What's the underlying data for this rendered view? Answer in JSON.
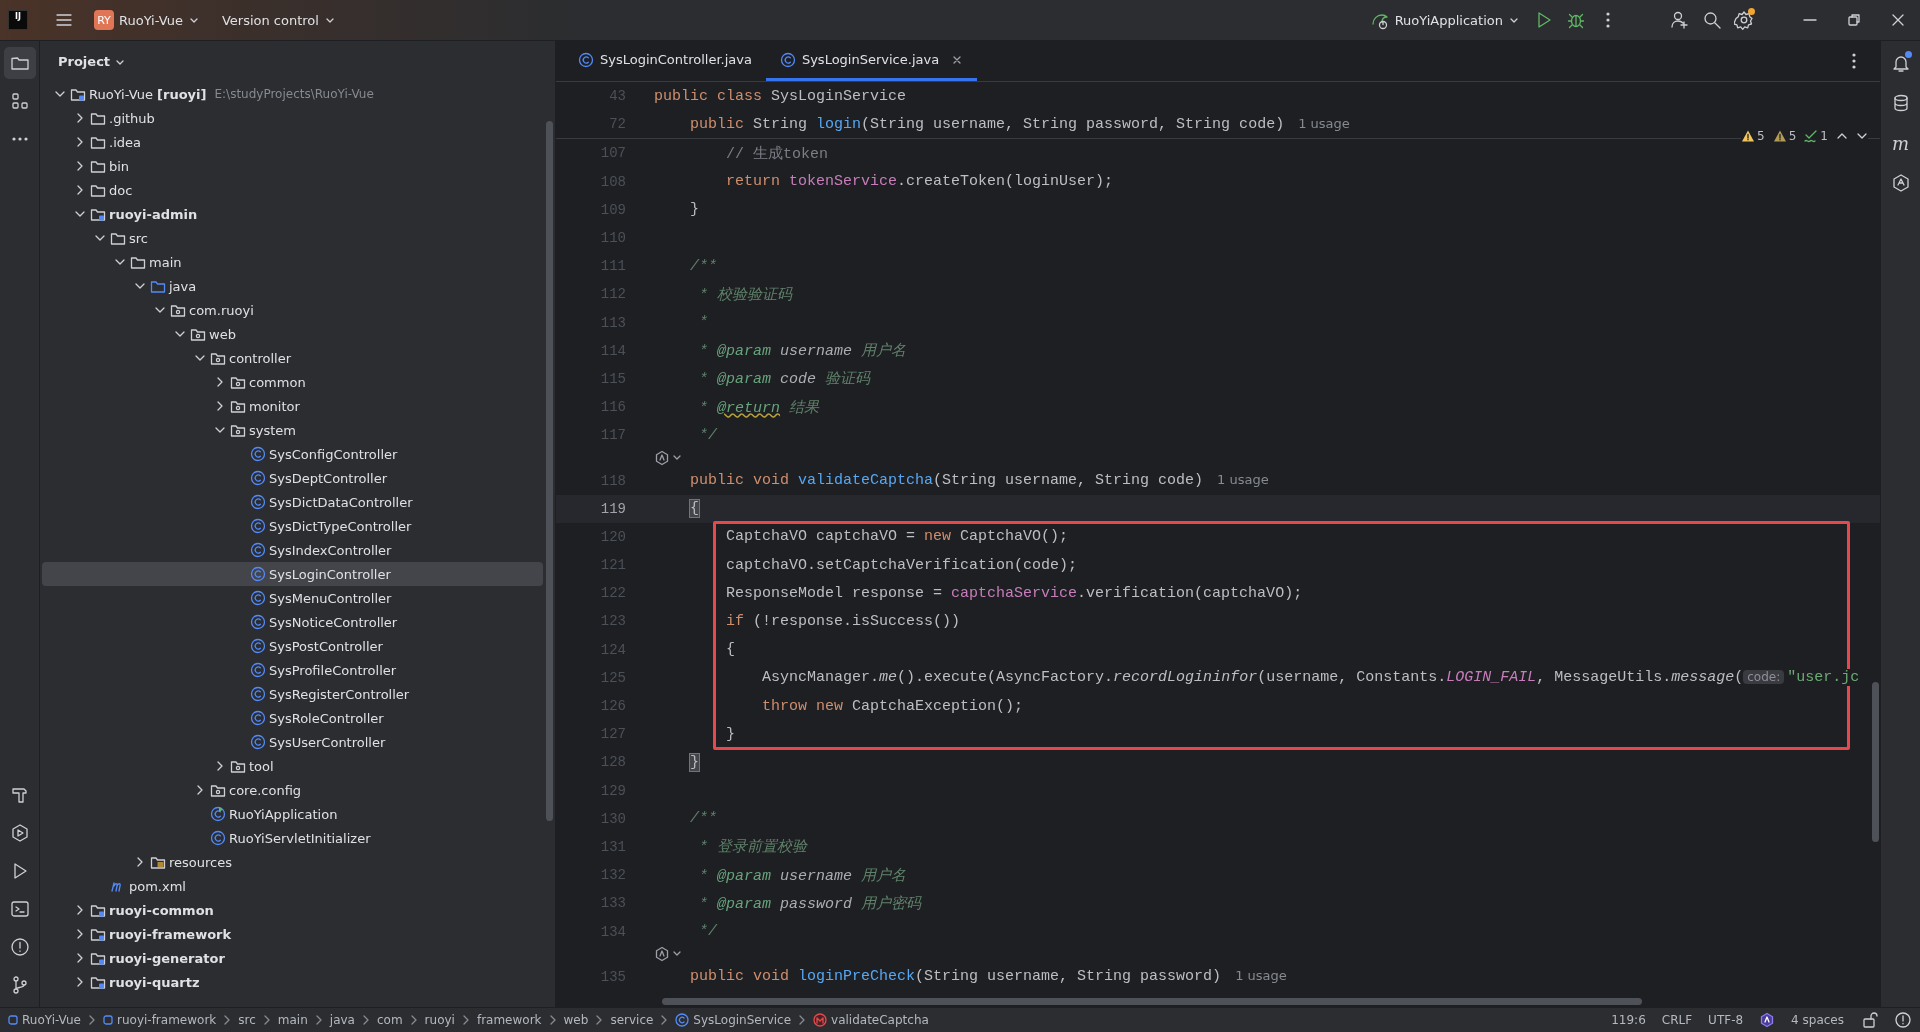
{
  "title_bar": {
    "logo": "IJ",
    "project_badge": "RY",
    "project": "RuoYi-Vue",
    "vcs": "Version control",
    "run_config": "RuoYiApplication",
    "settings_update": true
  },
  "left_toolbar": {
    "top": [
      {
        "selected": true
      },
      {
        "selected": false
      },
      {
        "selected": false
      }
    ],
    "bottom": [
      {
        "selected": false
      },
      {
        "selected": false
      },
      {
        "selected": false
      },
      {
        "selected": false
      },
      {
        "selected": false
      },
      {
        "selected": false
      }
    ]
  },
  "project_panel": {
    "title": "Project",
    "tree": [
      {
        "name": "RuoYi-Vue **[ruoyi]**",
        "hint": "E:\\studyProjects\\RuoYi-Vue",
        "kind": "module",
        "expanded": true,
        "selected": false,
        "children": [
          {
            "name": ".github",
            "kind": "folder",
            "expanded": false,
            "selected": false
          },
          {
            "name": ".idea",
            "kind": "folder",
            "expanded": false,
            "selected": false
          },
          {
            "name": "bin",
            "kind": "folder",
            "expanded": false,
            "selected": false
          },
          {
            "name": "doc",
            "kind": "folder",
            "expanded": false,
            "selected": false
          },
          {
            "name": "ruoyi-admin",
            "kind": "module",
            "bold": true,
            "expanded": true,
            "selected": false,
            "children": [
              {
                "name": "src",
                "kind": "folder",
                "expanded": true,
                "selected": false,
                "children": [
                  {
                    "name": "main",
                    "kind": "folder",
                    "expanded": true,
                    "selected": false,
                    "children": [
                      {
                        "name": "java",
                        "kind": "source",
                        "expanded": true,
                        "selected": false,
                        "children": [
                          {
                            "name": "com.ruoyi",
                            "kind": "package",
                            "expanded": true,
                            "selected": false,
                            "children": [
                              {
                                "name": "web",
                                "kind": "package",
                                "expanded": true,
                                "selected": false,
                                "children": [
                                  {
                                    "name": "controller",
                                    "kind": "package",
                                    "expanded": true,
                                    "selected": false,
                                    "children": [
                                      {
                                        "name": "common",
                                        "kind": "package",
                                        "expanded": false,
                                        "selected": false
                                      },
                                      {
                                        "name": "monitor",
                                        "kind": "package",
                                        "expanded": false,
                                        "selected": false
                                      },
                                      {
                                        "name": "system",
                                        "kind": "package",
                                        "expanded": true,
                                        "selected": false,
                                        "children": [
                                          {
                                            "name": "SysConfigController",
                                            "kind": "class",
                                            "selected": false
                                          },
                                          {
                                            "name": "SysDeptController",
                                            "kind": "class",
                                            "selected": false
                                          },
                                          {
                                            "name": "SysDictDataController",
                                            "kind": "class",
                                            "selected": false
                                          },
                                          {
                                            "name": "SysDictTypeController",
                                            "kind": "class",
                                            "selected": false
                                          },
                                          {
                                            "name": "SysIndexController",
                                            "kind": "class",
                                            "selected": false
                                          },
                                          {
                                            "name": "SysLoginController",
                                            "kind": "class",
                                            "selected": true
                                          },
                                          {
                                            "name": "SysMenuController",
                                            "kind": "class",
                                            "selected": false
                                          },
                                          {
                                            "name": "SysNoticeController",
                                            "kind": "class",
                                            "selected": false
                                          },
                                          {
                                            "name": "SysPostController",
                                            "kind": "class",
                                            "selected": false
                                          },
                                          {
                                            "name": "SysProfileController",
                                            "kind": "class",
                                            "selected": false
                                          },
                                          {
                                            "name": "SysRegisterController",
                                            "kind": "class",
                                            "selected": false
                                          },
                                          {
                                            "name": "SysRoleController",
                                            "kind": "class",
                                            "selected": false
                                          },
                                          {
                                            "name": "SysUserController",
                                            "kind": "class",
                                            "selected": false
                                          }
                                        ]
                                      },
                                      {
                                        "name": "tool",
                                        "kind": "package",
                                        "expanded": false,
                                        "selected": false
                                      }
                                    ]
                                  },
                                  {
                                    "name": "core.config",
                                    "kind": "package",
                                    "expanded": false,
                                    "selected": false
                                  },
                                  {
                                    "name": "RuoYiApplication",
                                    "kind": "app",
                                    "selected": false
                                  },
                                  {
                                    "name": "RuoYiServletInitializer",
                                    "kind": "class",
                                    "selected": false
                                  }
                                ]
                              }
                            ]
                          }
                        ]
                      },
                      {
                        "name": "resources",
                        "kind": "resources",
                        "expanded": false,
                        "selected": false
                      }
                    ]
                  }
                ]
              },
              {
                "name": "pom.xml",
                "kind": "maven",
                "selected": false
              }
            ]
          },
          {
            "name": "ruoyi-common",
            "kind": "module",
            "bold": true,
            "expanded": false,
            "selected": false
          },
          {
            "name": "ruoyi-framework",
            "kind": "module",
            "bold": true,
            "expanded": false,
            "selected": false
          },
          {
            "name": "ruoyi-generator",
            "kind": "module",
            "bold": true,
            "expanded": false,
            "selected": false
          },
          {
            "name": "ruoyi-quartz",
            "kind": "module",
            "bold": true,
            "expanded": false,
            "selected": false
          }
        ]
      }
    ]
  },
  "tabs": [
    {
      "label": "SysLoginController.java",
      "selected": false
    },
    {
      "label": "SysLoginService.java",
      "selected": true
    }
  ],
  "inspections": {
    "warnings": "5",
    "weak_warnings": "5",
    "typos": "1"
  },
  "editor": {
    "sticky_lines": [
      {
        "number": "43",
        "tokens": [
          {
            "kind": "kw",
            "text": "public class "
          },
          {
            "kind": "plain",
            "text": "SysLoginService"
          }
        ]
      },
      {
        "number": "72",
        "tokens": [
          {
            "kind": "kw",
            "text": "    public "
          },
          {
            "kind": "plain",
            "text": "String "
          },
          {
            "kind": "decl",
            "text": "login"
          },
          {
            "kind": "plain",
            "text": "(String username, String password, String code)"
          },
          {
            "kind": "hint",
            "text": "1 usage"
          }
        ]
      }
    ],
    "lines": [
      {
        "number": "107",
        "tokens": [
          {
            "kind": "comment",
            "text": "        // 生成token"
          }
        ]
      },
      {
        "number": "108",
        "tokens": [
          {
            "kind": "kw",
            "text": "        return "
          },
          {
            "kind": "field",
            "text": "tokenService"
          },
          {
            "kind": "plain",
            "text": ".createToken(loginUser);"
          }
        ]
      },
      {
        "number": "109",
        "tokens": [
          {
            "kind": "plain",
            "text": "    }"
          }
        ]
      },
      {
        "number": "110"
      },
      {
        "number": "111",
        "tokens": [
          {
            "kind": "doc",
            "text": "    /**"
          }
        ]
      },
      {
        "number": "112",
        "tokens": [
          {
            "kind": "doc",
            "text": "     * 校验验证码"
          }
        ]
      },
      {
        "number": "113",
        "tokens": [
          {
            "kind": "doc",
            "text": "     *"
          }
        ]
      },
      {
        "number": "114",
        "tokens": [
          {
            "kind": "doc",
            "text": "     * "
          },
          {
            "kind": "tag",
            "text": "@param"
          },
          {
            "kind": "docref",
            "text": " username"
          },
          {
            "kind": "doc",
            "text": " 用户名"
          }
        ]
      },
      {
        "number": "115",
        "tokens": [
          {
            "kind": "doc",
            "text": "     * "
          },
          {
            "kind": "tag",
            "text": "@param"
          },
          {
            "kind": "docref",
            "text": " code"
          },
          {
            "kind": "doc",
            "text": " 验证码"
          }
        ]
      },
      {
        "number": "116",
        "tokens": [
          {
            "kind": "doc",
            "text": "     * "
          },
          {
            "kind": "typo",
            "text": "@return"
          },
          {
            "kind": "doc",
            "text": " 结果"
          }
        ]
      },
      {
        "number": "117",
        "tokens": [
          {
            "kind": "doc",
            "text": "     */"
          }
        ]
      },
      {
        "kind": "inlay"
      },
      {
        "number": "118",
        "tokens": [
          {
            "kind": "kw",
            "text": "    public void "
          },
          {
            "kind": "decl",
            "text": "validateCaptcha"
          },
          {
            "kind": "plain",
            "text": "(String username, String code)"
          },
          {
            "kind": "hint",
            "text": "1 usage"
          }
        ]
      },
      {
        "number": "119",
        "current": true,
        "tokens": [
          {
            "kind": "brace",
            "text": "    {"
          }
        ]
      },
      {
        "number": "120",
        "boxed": true,
        "tokens": [
          {
            "kind": "plain",
            "text": "        CaptchaVO captchaVO = "
          },
          {
            "kind": "kw",
            "text": "new "
          },
          {
            "kind": "plain",
            "text": "CaptchaVO();"
          }
        ]
      },
      {
        "number": "121",
        "boxed": true,
        "tokens": [
          {
            "kind": "plain",
            "text": "        captchaVO.setCaptchaVerification(code);"
          }
        ]
      },
      {
        "number": "122",
        "boxed": true,
        "tokens": [
          {
            "kind": "plain",
            "text": "        ResponseModel response = "
          },
          {
            "kind": "field",
            "text": "captchaService"
          },
          {
            "kind": "plain",
            "text": ".verification(captchaVO);"
          }
        ]
      },
      {
        "number": "123",
        "boxed": true,
        "tokens": [
          {
            "kind": "kw",
            "text": "        if "
          },
          {
            "kind": "plain",
            "text": "(!response.isSuccess())"
          }
        ]
      },
      {
        "number": "124",
        "boxed": true,
        "tokens": [
          {
            "kind": "plain",
            "text": "        {"
          }
        ]
      },
      {
        "number": "125",
        "boxed": true,
        "tokens": [
          {
            "kind": "plain",
            "text": "            AsyncManager."
          },
          {
            "kind": "static",
            "text": "me"
          },
          {
            "kind": "plain",
            "text": "().execute(AsyncFactory."
          },
          {
            "kind": "static",
            "text": "recordLogininfor"
          },
          {
            "kind": "plain",
            "text": "(username, Constants."
          },
          {
            "kind": "const",
            "text": "LOGIN_FAIL"
          },
          {
            "kind": "plain",
            "text": ", MessageUtils."
          },
          {
            "kind": "static",
            "text": "message"
          },
          {
            "kind": "plain",
            "text": "("
          },
          {
            "kind": "param",
            "text": "code:"
          },
          {
            "kind": "str",
            "text": "\"user.jc"
          }
        ]
      },
      {
        "number": "126",
        "boxed": true,
        "tokens": [
          {
            "kind": "kw",
            "text": "            throw new "
          },
          {
            "kind": "plain",
            "text": "CaptchaException();"
          }
        ]
      },
      {
        "number": "127",
        "boxed": true,
        "tokens": [
          {
            "kind": "plain",
            "text": "        }"
          }
        ]
      },
      {
        "number": "128",
        "tokens": [
          {
            "kind": "brace",
            "text": "    }"
          }
        ]
      },
      {
        "number": "129"
      },
      {
        "number": "130",
        "tokens": [
          {
            "kind": "doc",
            "text": "    /**"
          }
        ]
      },
      {
        "number": "131",
        "tokens": [
          {
            "kind": "doc",
            "text": "     * 登录前置校验"
          }
        ]
      },
      {
        "number": "132",
        "tokens": [
          {
            "kind": "doc",
            "text": "     * "
          },
          {
            "kind": "tag",
            "text": "@param"
          },
          {
            "kind": "docref",
            "text": " username"
          },
          {
            "kind": "doc",
            "text": " 用户名"
          }
        ]
      },
      {
        "number": "133",
        "tokens": [
          {
            "kind": "doc",
            "text": "     * "
          },
          {
            "kind": "tag",
            "text": "@param"
          },
          {
            "kind": "docref",
            "text": " password"
          },
          {
            "kind": "doc",
            "text": " 用户密码"
          }
        ]
      },
      {
        "number": "134",
        "tokens": [
          {
            "kind": "doc",
            "text": "     */"
          }
        ]
      },
      {
        "kind": "inlay"
      },
      {
        "number": "135",
        "tokens": [
          {
            "kind": "kw",
            "text": "    public void "
          },
          {
            "kind": "decl",
            "text": "loginPreCheck"
          },
          {
            "kind": "plain",
            "text": "(String username, String password)"
          },
          {
            "kind": "hint",
            "text": "1 usage"
          }
        ]
      }
    ]
  },
  "right_toolbar": {
    "notifications_unread": true,
    "maven": "m"
  },
  "status_bar": {
    "breadcrumbs": [
      {
        "label": "RuoYi-Vue",
        "kind": "module"
      },
      {
        "label": "ruoyi-framework",
        "kind": "module"
      },
      {
        "label": "src",
        "kind": "plain"
      },
      {
        "label": "main",
        "kind": "plain"
      },
      {
        "label": "java",
        "kind": "plain"
      },
      {
        "label": "com",
        "kind": "plain"
      },
      {
        "label": "ruoyi",
        "kind": "plain"
      },
      {
        "label": "framework",
        "kind": "plain"
      },
      {
        "label": "web",
        "kind": "plain"
      },
      {
        "label": "service",
        "kind": "plain"
      },
      {
        "label": "SysLoginService",
        "kind": "class"
      },
      {
        "label": "validateCaptcha",
        "kind": "method"
      }
    ],
    "position": "119:6",
    "line_separator": "CRLF",
    "encoding": "UTF-8",
    "indent": "4 spaces"
  }
}
